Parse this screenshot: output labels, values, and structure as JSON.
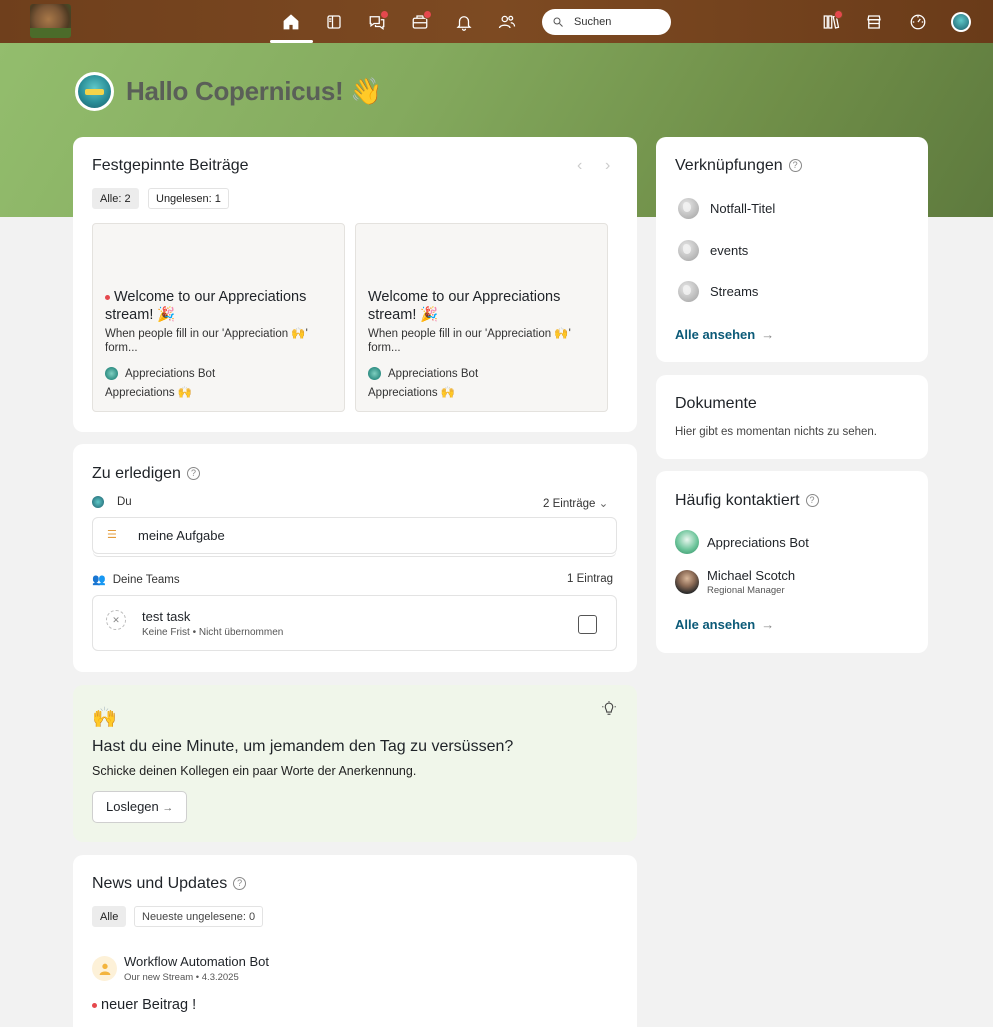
{
  "search": {
    "placeholder": "Suchen"
  },
  "hero": {
    "greeting": "Hallo Copernicus! 👋"
  },
  "pinned": {
    "title": "Festgepinnte Beiträge",
    "filters": [
      "Alle: 2",
      "Ungelesen: 1"
    ],
    "posts": [
      {
        "title": "Welcome to our Appreciations stream! 🎉",
        "description": "When people fill in our 'Appreciation 🙌' form...",
        "author": "Appreciations Bot",
        "stream": "Appreciations 🙌",
        "unread": true
      },
      {
        "title": "Welcome to our Appreciations stream! 🎉",
        "description": "When people fill in our 'Appreciation 🙌' form...",
        "author": "Appreciations Bot",
        "stream": "Appreciations 🙌",
        "unread": false
      }
    ]
  },
  "links": {
    "title": "Verknüpfungen",
    "items": [
      "Notfall-Titel",
      "events",
      "Streams"
    ],
    "see_all": "Alle ansehen"
  },
  "documents": {
    "title": "Dokumente",
    "empty": "Hier gibt es momentan nichts zu sehen."
  },
  "contacts": {
    "title": "Häufig kontaktiert",
    "people": [
      {
        "name": "Appreciations Bot",
        "role": ""
      },
      {
        "name": "Michael Scotch",
        "role": "Regional Manager"
      }
    ],
    "see_all": "Alle ansehen"
  },
  "todo": {
    "title": "Zu erledigen",
    "you_label": "Du",
    "you_count": "2 Einträge",
    "my_task": "meine Aufgabe",
    "teams_label": "Deine Teams",
    "teams_count": "1 Eintrag",
    "team_task": "test task",
    "team_task_meta": "Keine Frist • Nicht übernommen"
  },
  "appreciation": {
    "emoji": "🙌",
    "title": "Hast du eine Minute, um jemandem den Tag zu versüssen?",
    "text": "Schicke deinen Kollegen ein paar Worte der Anerkennung.",
    "button": "Loslegen"
  },
  "news": {
    "title": "News und Updates",
    "filters": [
      "Alle",
      "Neueste ungelesene: 0"
    ],
    "author": "Workflow Automation Bot",
    "meta": "Our new Stream • 4.3.2025",
    "post_title": "neuer Beitrag !"
  }
}
